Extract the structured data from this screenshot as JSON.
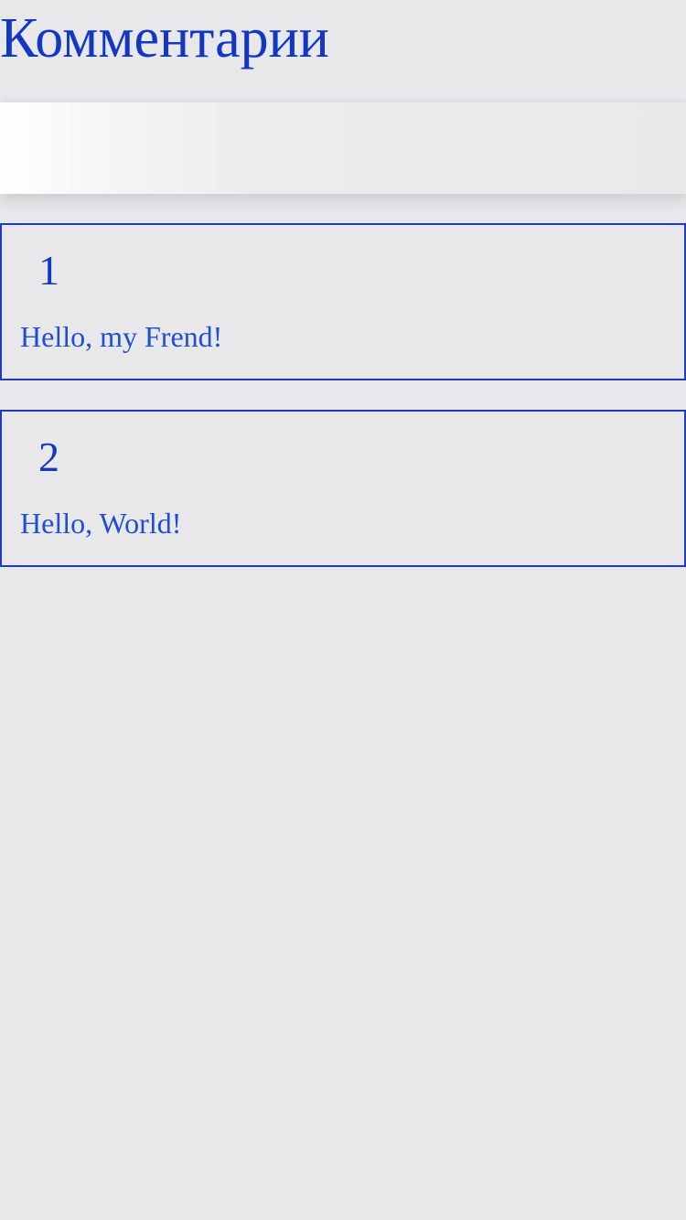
{
  "page": {
    "title": "Комментарии"
  },
  "comment_form": {
    "input_value": "",
    "input_placeholder": ""
  },
  "comments": [
    {
      "id": "1",
      "text": "Hello, my Frend!"
    },
    {
      "id": "2",
      "text": "Hello, World!"
    }
  ],
  "colors": {
    "accent": "#1237c4",
    "text": "#1f4fd0",
    "border": "#1d3cc0",
    "background": "#e8e8eb"
  }
}
